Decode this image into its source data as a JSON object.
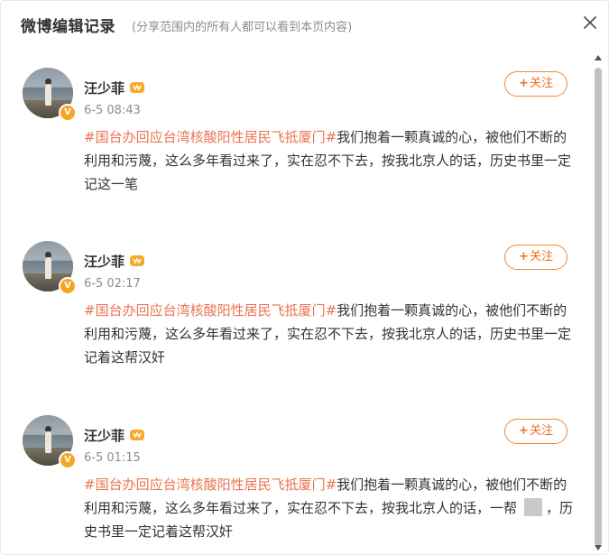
{
  "dialog": {
    "title": "微博编辑记录",
    "subtitle": "(分享范围内的所有人都可以看到本页内容)",
    "close_icon": "close-icon"
  },
  "colors": {
    "accent": "#f0701a",
    "topic": "#eb7350",
    "badge": "#f5a623",
    "muted": "#8d8d8d"
  },
  "posts": [
    {
      "name": "汪少菲",
      "time": "6-5 08:43",
      "follow_label": "关注",
      "topic": "#国台办回应台湾核酸阳性居民飞抵厦门#",
      "text": "我们抱着一颗真诚的心，被他们不断的利用和污蔑，这么多年看过来了，实在忍不下去，按我北京人的话，历史书里一定记这一笔"
    },
    {
      "name": "汪少菲",
      "time": "6-5 02:17",
      "follow_label": "关注",
      "topic": "#国台办回应台湾核酸阳性居民飞抵厦门#",
      "text": "我们抱着一颗真诚的心，被他们不断的利用和污蔑，这么多年看过来了，实在忍不下去，按我北京人的话，历史书里一定记着这帮汉奸"
    },
    {
      "name": "汪少菲",
      "time": "6-5 01:15",
      "follow_label": "关注",
      "topic": "#国台办回应台湾核酸阳性居民飞抵厦门#",
      "text": "我们抱着一颗真诚的心，被他们不断的利用和污蔑，这么多年看过来了，实在忍不下去，按我北京人的话，一帮",
      "text_after": "，历史书里一定记着这帮汉奸"
    }
  ],
  "badge_letter": "V"
}
